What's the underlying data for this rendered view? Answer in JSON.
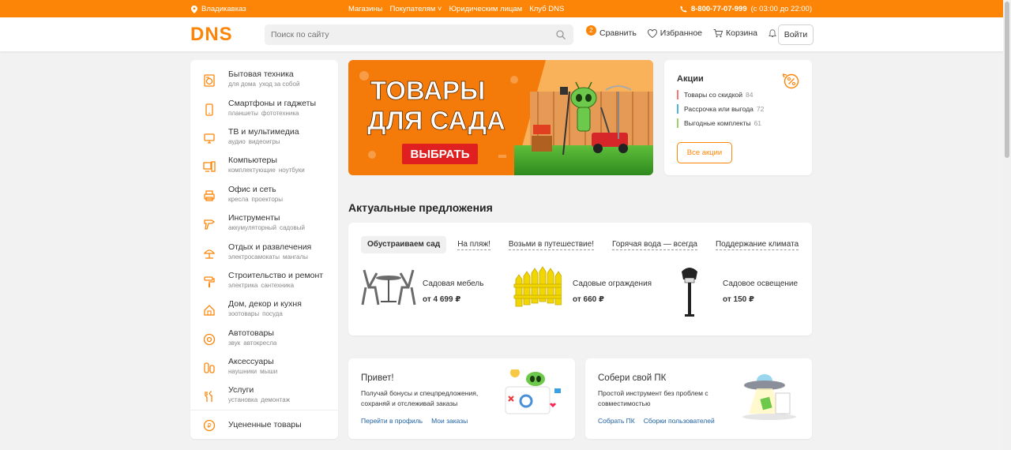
{
  "topbar": {
    "city": "Владикавказ",
    "links": [
      "Магазины",
      "Покупателям",
      "Юридическим лицам",
      "Клуб DNS"
    ],
    "phone": "8-800-77-07-999",
    "hours": "(с 03:00 до 22:00)"
  },
  "header": {
    "logo_text": "DNS",
    "search_placeholder": "Поиск по сайту",
    "compare_label": "Сравнить",
    "compare_count": "2",
    "favorites_label": "Избранное",
    "cart_label": "Корзина",
    "login_label": "Войти"
  },
  "catalog": {
    "items": [
      {
        "title": "Бытовая техника",
        "sub": [
          "для дома",
          "уход за собой"
        ],
        "icon": "washer-icon"
      },
      {
        "title": "Смартфоны и гаджеты",
        "sub": [
          "планшеты",
          "фототехника"
        ],
        "icon": "phone-icon"
      },
      {
        "title": "ТВ и мультимедиа",
        "sub": [
          "аудио",
          "видеоигры"
        ],
        "icon": "tv-icon"
      },
      {
        "title": "Компьютеры",
        "sub": [
          "комплектующие",
          "ноутбуки"
        ],
        "icon": "computer-icon"
      },
      {
        "title": "Офис и сеть",
        "sub": [
          "кресла",
          "проекторы"
        ],
        "icon": "printer-icon"
      },
      {
        "title": "Инструменты",
        "sub": [
          "аккумуляторный",
          "садовый"
        ],
        "icon": "drill-icon"
      },
      {
        "title": "Отдых и развлечения",
        "sub": [
          "электросамокаты",
          "мангалы"
        ],
        "icon": "umbrella-icon"
      },
      {
        "title": "Строительство и ремонт",
        "sub": [
          "электрика",
          "сантехника"
        ],
        "icon": "paint-roller-icon"
      },
      {
        "title": "Дом, декор и кухня",
        "sub": [
          "зоотовары",
          "посуда"
        ],
        "icon": "house-icon"
      },
      {
        "title": "Автотовары",
        "sub": [
          "звук",
          "автокресла"
        ],
        "icon": "wheel-icon"
      },
      {
        "title": "Аксессуары",
        "sub": [
          "наушники",
          "мыши"
        ],
        "icon": "accessories-icon"
      },
      {
        "title": "Услуги",
        "sub": [
          "установка",
          "демонтаж"
        ],
        "icon": "tools-icon"
      }
    ],
    "discounted": "Уцененные товары"
  },
  "banner": {
    "line1": "ТОВАРЫ",
    "line2": "ДЛЯ САДА",
    "button": "ВЫБРАТЬ"
  },
  "promo": {
    "title": "Акции",
    "items": [
      {
        "label": "Товары со скидкой",
        "count": "84",
        "color": "#f47a7a"
      },
      {
        "label": "Рассрочка или выгода",
        "count": "72",
        "color": "#4fb8d9"
      },
      {
        "label": "Выгодные комплекты",
        "count": "61",
        "color": "#9ed26a"
      }
    ],
    "all_button": "Все акции"
  },
  "offers": {
    "title": "Актуальные предложения",
    "tabs": [
      "Обустраиваем сад",
      "На пляж!",
      "Возьми в путешествие!",
      "Горячая вода — всегда",
      "Поддержание климата"
    ],
    "products": [
      {
        "name": "Садовая мебель",
        "price": "от 4 699 ₽"
      },
      {
        "name": "Садовые ограждения",
        "price": "от 660 ₽"
      },
      {
        "name": "Садовое освещение",
        "price": "от 150 ₽"
      }
    ]
  },
  "cards": {
    "hello": {
      "title": "Привет!",
      "desc": "Получай бонусы и спецпредложения, сохраняй и отслеживай заказы",
      "links": [
        "Перейти в профиль",
        "Мои заказы"
      ]
    },
    "pc": {
      "title": "Собери свой ПК",
      "desc": "Простой инструмент без проблем с совместимостью",
      "links": [
        "Собрать ПК",
        "Сборки пользователей"
      ]
    }
  },
  "colors": {
    "accent": "#fc8507",
    "link": "#2062a3"
  }
}
